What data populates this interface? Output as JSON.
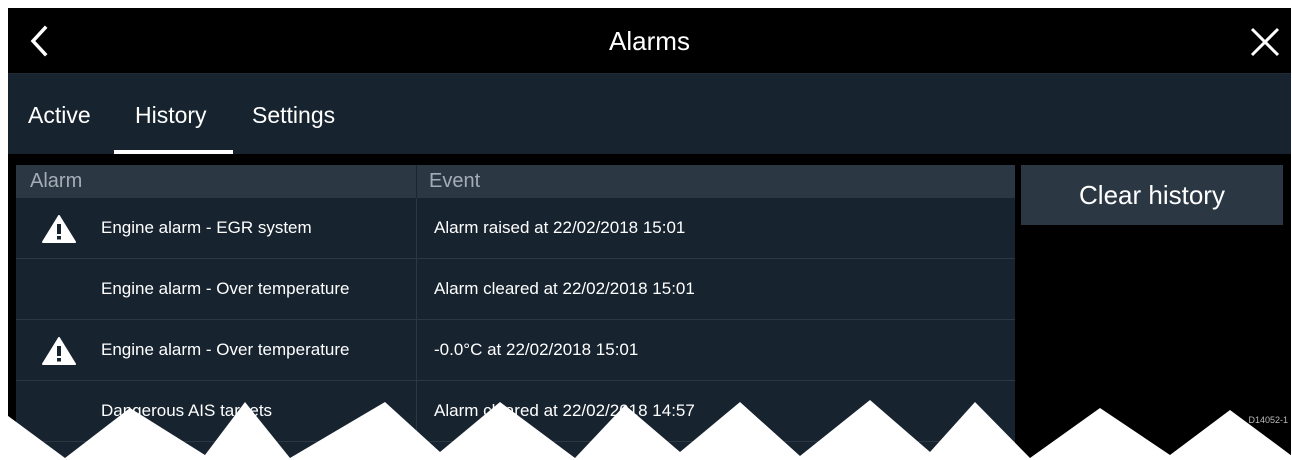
{
  "header": {
    "title": "Alarms",
    "back_icon": "chevron-left-icon",
    "close_icon": "close-icon"
  },
  "tabs": [
    {
      "label": "Active",
      "selected": false
    },
    {
      "label": "History",
      "selected": true
    },
    {
      "label": "Settings",
      "selected": false
    }
  ],
  "table": {
    "columns": [
      "Alarm",
      "Event"
    ],
    "rows": [
      {
        "alarm": "Engine alarm - EGR system",
        "event": "Alarm raised at 22/02/2018 15:01",
        "icon": "warning-icon"
      },
      {
        "alarm": "Engine alarm - Over temperature",
        "event": "Alarm cleared at 22/02/2018 15:01",
        "icon": ""
      },
      {
        "alarm": "Engine alarm - Over temperature",
        "event": "-0.0°C at 22/02/2018 15:01",
        "icon": "warning-icon"
      },
      {
        "alarm": "Dangerous AIS targets",
        "event": "Alarm cleared at 22/02/2018 14:57",
        "icon": ""
      }
    ]
  },
  "actions": {
    "clear_history_label": "Clear history"
  },
  "figure_code": "D14052-1",
  "colors": {
    "background": "#000000",
    "panel": "#17232f",
    "header_row": "#2b3743",
    "text": "#ffffff"
  }
}
